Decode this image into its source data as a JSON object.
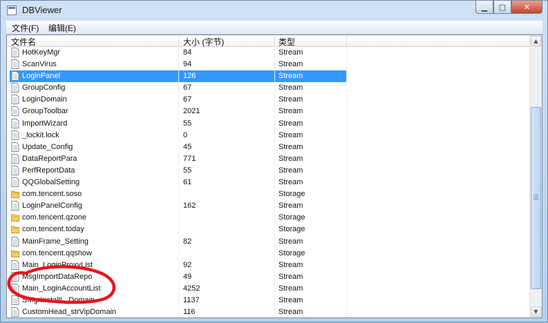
{
  "window": {
    "title": "DBViewer",
    "min_label": "▁",
    "max_label": "□",
    "close_label": "✕"
  },
  "menu": {
    "items": [
      {
        "label": "文件(F)"
      },
      {
        "label": "编辑(E)"
      }
    ]
  },
  "table": {
    "columns": [
      "文件名",
      "大小 (字节)",
      "类型"
    ],
    "rows": [
      {
        "name": "HotKeyMgr",
        "size": "84",
        "type": "Stream",
        "icon": "file-icon"
      },
      {
        "name": "ScanVirus",
        "size": "94",
        "type": "Stream",
        "icon": "file-icon"
      },
      {
        "name": "LoginPanel",
        "size": "126",
        "type": "Stream",
        "icon": "file-icon",
        "selected": true
      },
      {
        "name": "GroupConfig",
        "size": "67",
        "type": "Stream",
        "icon": "file-icon"
      },
      {
        "name": "LoginDomain",
        "size": "67",
        "type": "Stream",
        "icon": "file-icon"
      },
      {
        "name": "GroupToolbar",
        "size": "2021",
        "type": "Stream",
        "icon": "file-icon"
      },
      {
        "name": "ImportWizard",
        "size": "55",
        "type": "Stream",
        "icon": "file-icon"
      },
      {
        "name": "_lockit.lock",
        "size": "0",
        "type": "Stream",
        "icon": "file-icon"
      },
      {
        "name": "Update_Config",
        "size": "45",
        "type": "Stream",
        "icon": "file-icon"
      },
      {
        "name": "DataReportPara",
        "size": "771",
        "type": "Stream",
        "icon": "file-icon"
      },
      {
        "name": "PerfReportData",
        "size": "55",
        "type": "Stream",
        "icon": "file-icon"
      },
      {
        "name": "QQGlobalSetting",
        "size": "61",
        "type": "Stream",
        "icon": "file-icon"
      },
      {
        "name": "com.tencent.soso",
        "size": "",
        "type": "Storage",
        "icon": "folder-icon"
      },
      {
        "name": "LoginPanelConfig",
        "size": "162",
        "type": "Stream",
        "icon": "file-icon"
      },
      {
        "name": "com.tencent.qzone",
        "size": "",
        "type": "Storage",
        "icon": "folder-icon"
      },
      {
        "name": "com.tencent.today",
        "size": "",
        "type": "Storage",
        "icon": "folder-icon"
      },
      {
        "name": "MainFrame_Setting",
        "size": "82",
        "type": "Stream",
        "icon": "file-icon"
      },
      {
        "name": "com.tencent.qqshow",
        "size": "",
        "type": "Storage",
        "icon": "folder-icon"
      },
      {
        "name": "Main_LoginProxyList",
        "size": "92",
        "type": "Stream",
        "icon": "file-icon"
      },
      {
        "name": "MsgImportDataRepo",
        "size": "49",
        "type": "Stream",
        "icon": "file-icon"
      },
      {
        "name": "Main_LoginAccountList",
        "size": "4252",
        "type": "Stream",
        "icon": "file-icon"
      },
      {
        "name": "SMgrInstallL_Domain",
        "size": "1137",
        "type": "Stream",
        "icon": "file-icon"
      },
      {
        "name": "CustomHead_strVipDomain",
        "size": "116",
        "type": "Stream",
        "icon": "file-icon"
      }
    ]
  },
  "scrollbar": {
    "up": "▲",
    "down": "▼",
    "grip": "≡"
  },
  "colors": {
    "selection": "#3399ff",
    "annotation": "#e8141c"
  }
}
